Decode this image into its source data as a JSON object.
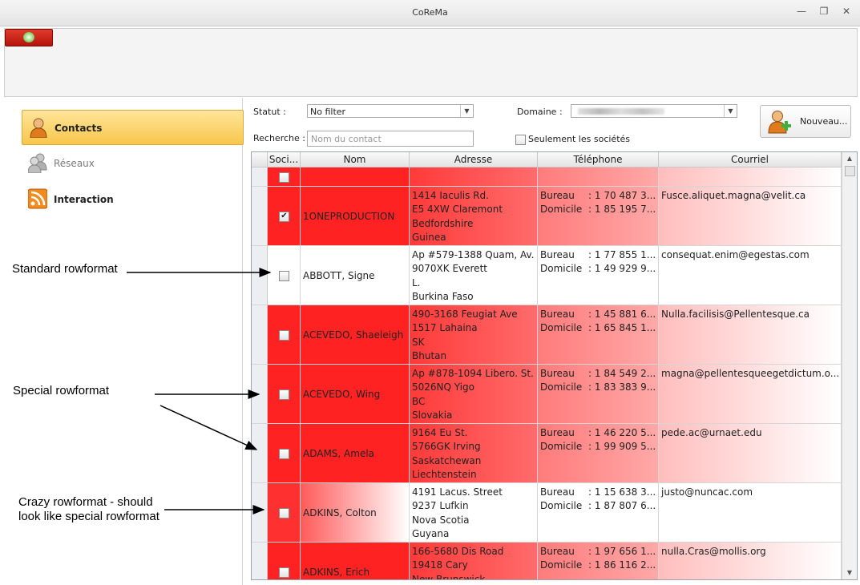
{
  "window": {
    "title": "CoReMa"
  },
  "sidebar": {
    "items": [
      {
        "label": "Contacts",
        "icon": "contacts-person-icon"
      },
      {
        "label": "Réseaux",
        "icon": "network-people-icon"
      },
      {
        "label": "Interaction",
        "icon": "rss-feed-icon"
      }
    ]
  },
  "filters": {
    "statut_label": "Statut :",
    "statut_value": "No filter",
    "domaine_label": "Domaine :",
    "recherche_label": "Recherche :",
    "search_placeholder": "Nom du contact",
    "only_companies_label": "Seulement les sociétés",
    "new_button_label": "Nouveau..."
  },
  "grid": {
    "columns": [
      "Soci...",
      "Nom",
      "Adresse",
      "Téléphone",
      "Courriel"
    ],
    "rows": [
      {
        "societe": false,
        "nom": "",
        "adresse": [],
        "tel_bureau": "",
        "tel_domicile": "",
        "courriel": "",
        "format": "special"
      },
      {
        "societe": true,
        "nom": "1ONEPRODUCTION",
        "adresse": [
          "1414 Iaculis Rd.",
          "E5 4XW Claremont",
          "Bedfordshire",
          "Guinea"
        ],
        "tel_bureau": "1 70 487 3...",
        "tel_domicile": "1 85 195 7...",
        "courriel": "Fusce.aliquet.magna@velit.ca",
        "format": "special"
      },
      {
        "societe": false,
        "nom": "ABBOTT, Signe",
        "adresse": [
          "Ap #579-1388 Quam, Av.",
          "9070XK Everett",
          "L.",
          "Burkina Faso"
        ],
        "tel_bureau": "1 77 855 1...",
        "tel_domicile": "1 49 929 9...",
        "courriel": "consequat.enim@egestas.com",
        "format": "standard"
      },
      {
        "societe": false,
        "nom": "ACEVEDO, Shaeleigh",
        "adresse": [
          "490-3168 Feugiat Ave",
          "1517 Lahaina",
          "SK",
          "Bhutan"
        ],
        "tel_bureau": "1 45 881 6...",
        "tel_domicile": "1 65 845 1...",
        "courriel": "Nulla.facilisis@Pellentesque.ca",
        "format": "special"
      },
      {
        "societe": false,
        "nom": "ACEVEDO, Wing",
        "adresse": [
          "Ap #878-1094 Libero. St.",
          "5026NQ Yigo",
          "BC",
          "Slovakia"
        ],
        "tel_bureau": "1 84 549 2...",
        "tel_domicile": "1 83 383 9...",
        "courriel": "magna@pellentesqueegetdictum.o...",
        "format": "special"
      },
      {
        "societe": false,
        "nom": "ADAMS, Amela",
        "adresse": [
          "9164 Eu St.",
          "5766GK Irving",
          "Saskatchewan",
          "Liechtenstein"
        ],
        "tel_bureau": "1 46 220 5...",
        "tel_domicile": "1 99 909 5...",
        "courriel": "pede.ac@urnaet.edu",
        "format": "special"
      },
      {
        "societe": false,
        "nom": "ADKINS, Colton",
        "adresse": [
          "4191 Lacus. Street",
          "9237 Lufkin",
          "Nova Scotia",
          "Guyana"
        ],
        "tel_bureau": "1 15 638 3...",
        "tel_domicile": "1 87 807 6...",
        "courriel": "justo@nuncac.com",
        "format": "crazy"
      },
      {
        "societe": false,
        "nom": "ADKINS, Erich",
        "adresse": [
          "166-5680 Dis Road",
          "19418 Cary",
          "New Brunswick",
          ""
        ],
        "tel_bureau": "1 97 656 1...",
        "tel_domicile": "1 86 116 2...",
        "courriel": "nulla.Cras@mollis.org",
        "format": "special"
      }
    ],
    "tel_labels": {
      "bureau": "Bureau",
      "domicile": "Domicile",
      "separator": ":"
    }
  },
  "annotations": {
    "standard": "Standard rowformat",
    "special": "Special rowformat",
    "crazy_line1": "Crazy rowformat - should",
    "crazy_line2": "look like special rowformat"
  },
  "colors": {
    "special_red": "#ff2222",
    "nav_active": "#f8c64a"
  }
}
